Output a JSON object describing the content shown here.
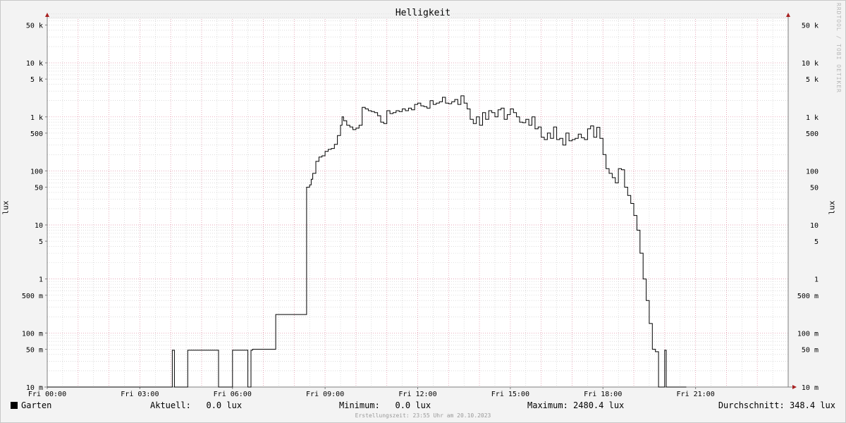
{
  "watermark": "RRDTOOL / TOBI OETIKER",
  "legend": {
    "series_name": "Garten",
    "current_label": "Aktuell:",
    "current_value": "0.0 lux",
    "min_label": "Minimum:",
    "min_value": "0.0 lux",
    "max_label": "Maximum:",
    "max_value": "2480.4 lux",
    "avg_label": "Durchschnitt:",
    "avg_value": "348.4 lux"
  },
  "footer": "Erstellungszeit: 23:55 Uhr am 20.10.2023",
  "colors": {
    "line": "#000000",
    "major_grid": "#e89bb0",
    "minor_grid": "#c8c8c8",
    "axis": "#7f7f7f",
    "arrow": "#a82020",
    "background": "#ffffff",
    "canvas": "#f3f3f3"
  },
  "chart_data": {
    "type": "line",
    "title": "Helligkeit",
    "ylabel": "lux",
    "yscale": "log",
    "ylim": [
      0.01,
      80000
    ],
    "xlim_hours": [
      0,
      24
    ],
    "x_tick_hours": [
      0,
      3,
      6,
      9,
      12,
      15,
      18,
      21
    ],
    "x_tick_labels": [
      "Fri 00:00",
      "Fri 03:00",
      "Fri 06:00",
      "Fri 09:00",
      "Fri 12:00",
      "Fri 15:00",
      "Fri 18:00",
      "Fri 21:00"
    ],
    "y_tick_values": [
      0.01,
      0.05,
      0.1,
      0.5,
      1,
      5,
      10,
      50,
      100,
      500,
      1000,
      5000,
      10000,
      50000
    ],
    "y_tick_labels": [
      "10 m",
      "50 m",
      "100 m",
      "500 m",
      "1",
      "5",
      "10",
      "50",
      "100",
      "500",
      "1 k",
      "5 k",
      "10 k",
      "50 k"
    ],
    "grid": true,
    "series": [
      {
        "name": "Garten",
        "x_hours": [
          0,
          4.05,
          4.05,
          4.12,
          4.12,
          4.55,
          4.55,
          5.55,
          5.55,
          6.0,
          6.0,
          6.5,
          6.5,
          6.6,
          6.6,
          6.65,
          6.65,
          7.4,
          7.4,
          7.5,
          7.5,
          8.4,
          8.4,
          8.5,
          8.55,
          8.6,
          8.7,
          8.8,
          8.9,
          9.0,
          9.1,
          9.2,
          9.3,
          9.4,
          9.5,
          9.55,
          9.6,
          9.7,
          9.8,
          9.9,
          10.0,
          10.1,
          10.2,
          10.3,
          10.4,
          10.5,
          10.6,
          10.7,
          10.8,
          10.9,
          11.0,
          11.1,
          11.2,
          11.3,
          11.4,
          11.5,
          11.6,
          11.7,
          11.8,
          11.9,
          12.0,
          12.1,
          12.2,
          12.3,
          12.4,
          12.5,
          12.6,
          12.7,
          12.8,
          12.9,
          13.0,
          13.1,
          13.2,
          13.3,
          13.4,
          13.5,
          13.6,
          13.7,
          13.8,
          13.9,
          14.0,
          14.1,
          14.2,
          14.3,
          14.4,
          14.5,
          14.6,
          14.7,
          14.8,
          14.9,
          15.0,
          15.1,
          15.2,
          15.3,
          15.4,
          15.5,
          15.6,
          15.7,
          15.8,
          15.9,
          16.0,
          16.1,
          16.2,
          16.3,
          16.4,
          16.5,
          16.6,
          16.7,
          16.8,
          16.9,
          17.0,
          17.1,
          17.2,
          17.3,
          17.4,
          17.5,
          17.6,
          17.7,
          17.8,
          17.9,
          18.0,
          18.1,
          18.2,
          18.3,
          18.4,
          18.5,
          18.6,
          18.7,
          18.8,
          18.9,
          19.0,
          19.1,
          19.2,
          19.3,
          19.4,
          19.5,
          19.6,
          19.7,
          19.8,
          19.9,
          20.0,
          20.05,
          20.05,
          20.7,
          20.7,
          21.0,
          21.0,
          24
        ],
        "values": [
          0.01,
          0.01,
          0.048,
          0.048,
          0.01,
          0.01,
          0.048,
          0.048,
          0.01,
          0.01,
          0.048,
          0.048,
          0.01,
          0.01,
          0.048,
          0.048,
          0.05,
          0.05,
          0.22,
          0.22,
          0.22,
          0.22,
          50,
          55,
          70,
          90,
          150,
          180,
          190,
          230,
          250,
          260,
          310,
          450,
          700,
          1000,
          850,
          700,
          650,
          580,
          620,
          700,
          1500,
          1400,
          1300,
          1250,
          1200,
          1050,
          800,
          750,
          1300,
          1150,
          1200,
          1300,
          1250,
          1400,
          1300,
          1450,
          1350,
          1700,
          1800,
          1600,
          1550,
          1450,
          2000,
          1700,
          1800,
          1900,
          2300,
          1800,
          1750,
          1900,
          2100,
          1700,
          2450,
          1800,
          1400,
          900,
          750,
          1000,
          700,
          1200,
          900,
          1300,
          1200,
          1000,
          1350,
          1450,
          900,
          1100,
          1400,
          1200,
          1000,
          800,
          780,
          900,
          700,
          1000,
          600,
          650,
          420,
          380,
          500,
          400,
          650,
          380,
          400,
          300,
          500,
          360,
          380,
          400,
          480,
          410,
          380,
          600,
          680,
          420,
          640,
          400,
          200,
          110,
          90,
          75,
          60,
          110,
          105,
          50,
          35,
          25,
          15,
          8,
          3,
          1,
          0.4,
          0.15,
          0.05,
          0.045,
          0.01,
          0.01,
          0.048,
          0.048,
          0.01,
          0.01
        ]
      }
    ]
  }
}
